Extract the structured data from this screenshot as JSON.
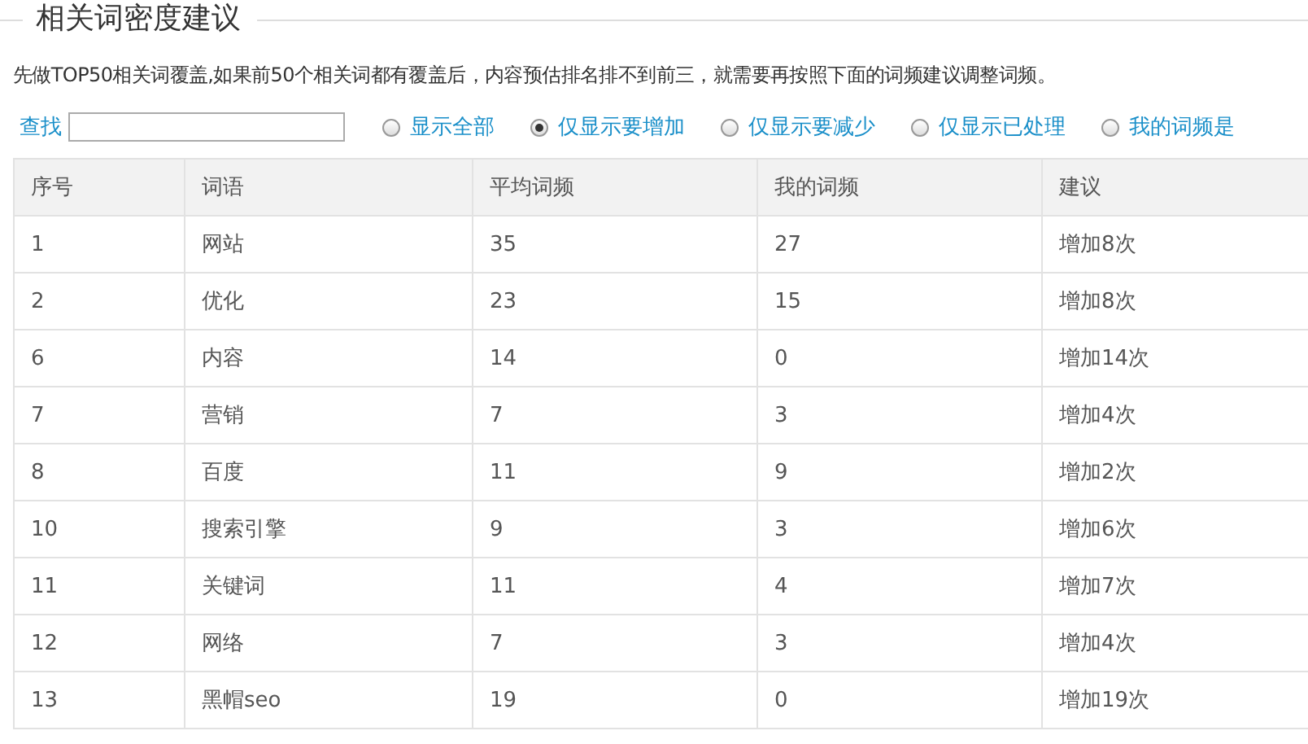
{
  "title": "相关词密度建议",
  "description": "先做TOP50相关词覆盖,如果前50个相关词都有覆盖后，内容预估排名排不到前三，就需要再按照下面的词频建议调整词频。",
  "search": {
    "label": "查找"
  },
  "filters": [
    {
      "label": "显示全部",
      "selected": false
    },
    {
      "label": "仅显示要增加",
      "selected": true
    },
    {
      "label": "仅显示要减少",
      "selected": false
    },
    {
      "label": "仅显示已处理",
      "selected": false
    },
    {
      "label": "我的词频是",
      "selected": false
    }
  ],
  "table": {
    "columns": [
      "序号",
      "词语",
      "平均词频",
      "我的词频",
      "建议"
    ],
    "rows": [
      [
        "1",
        "网站",
        "35",
        "27",
        "增加8次"
      ],
      [
        "2",
        "优化",
        "23",
        "15",
        "增加8次"
      ],
      [
        "6",
        "内容",
        "14",
        "0",
        "增加14次"
      ],
      [
        "7",
        "营销",
        "7",
        "3",
        "增加4次"
      ],
      [
        "8",
        "百度",
        "11",
        "9",
        "增加2次"
      ],
      [
        "10",
        "搜索引擎",
        "9",
        "3",
        "增加6次"
      ],
      [
        "11",
        "关键词",
        "11",
        "4",
        "增加7次"
      ],
      [
        "12",
        "网络",
        "7",
        "3",
        "增加4次"
      ],
      [
        "13",
        "黑帽seo",
        "19",
        "0",
        "增加19次"
      ]
    ]
  }
}
